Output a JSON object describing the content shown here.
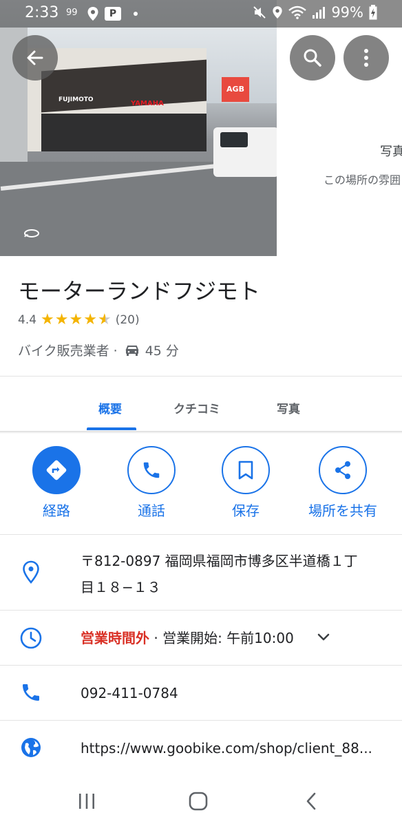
{
  "status_bar": {
    "time": "2:33",
    "small_text": "99",
    "p_badge": "P",
    "battery": "99%",
    "icons": [
      "location-icon",
      "p-app-icon",
      "dot-icon",
      "mute-icon",
      "location-icon",
      "wifi-icon",
      "signal-icon",
      "battery-icon"
    ]
  },
  "hero": {
    "side_title": "写真",
    "side_subtitle": "この場所の雰囲",
    "store_sign_1": "FUJIMOTO",
    "store_sign_2": "YAMAHA",
    "store_sign_3": "AGB"
  },
  "place": {
    "name": "モーターランドフジモト",
    "rating": "4.4",
    "stars_value": 4.4,
    "review_count": "(20)",
    "category": "バイク販売業者 ·",
    "drive_time": "45 分"
  },
  "tabs": [
    {
      "label": "概要",
      "active": true
    },
    {
      "label": "クチコミ",
      "active": false
    },
    {
      "label": "写真",
      "active": false
    }
  ],
  "actions": [
    {
      "label": "経路",
      "icon": "directions-icon"
    },
    {
      "label": "通話",
      "icon": "phone-icon"
    },
    {
      "label": "保存",
      "icon": "bookmark-icon"
    },
    {
      "label": "場所を共有",
      "icon": "share-icon"
    }
  ],
  "info": {
    "address_line1": "〒812-0897 福岡県福岡市博多区半道橋１丁",
    "address_line2": "目１８−１３",
    "hours_status": "営業時間外",
    "hours_detail": " · 営業開始: 午前10:00",
    "phone": "092-411-0784",
    "website": "https://www.goobike.com/shop/client_88..."
  },
  "colors": {
    "accent": "#1a73e8",
    "closed": "#d93025",
    "star": "#f4b400"
  }
}
